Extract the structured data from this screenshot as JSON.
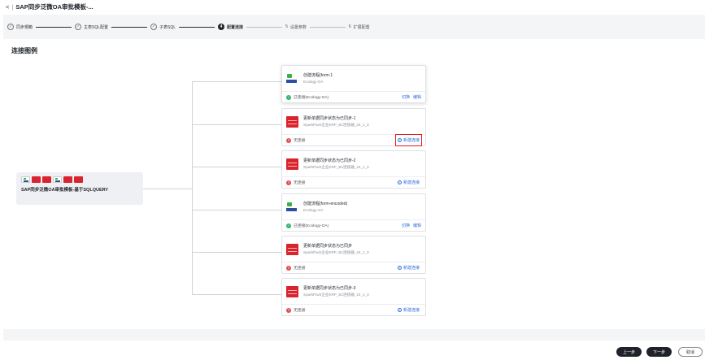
{
  "header": {
    "back_icon": "chevron-left-icon",
    "title": "SAP同步泛微OA审批模板-..."
  },
  "steps": [
    {
      "label": "同步規範",
      "state": "done",
      "marker": "✓"
    },
    {
      "label": "主表SQL配置",
      "state": "done",
      "marker": "✓"
    },
    {
      "label": "子表SQL",
      "state": "done",
      "marker": "✓"
    },
    {
      "label": "配置连接",
      "state": "active",
      "marker": "4"
    },
    {
      "label": "设置参数",
      "state": "todo",
      "marker": "5"
    },
    {
      "label": "扩展配置",
      "state": "todo",
      "marker": "6"
    }
  ],
  "section_title": "连接图例",
  "source": {
    "title": "SAP同步泛微OA审批模板-基于SQLQUERY"
  },
  "cards": [
    {
      "name": "创建流程(form-1",
      "sub": "Ecology-OA",
      "logo": "oa",
      "status": "已连接(Ecology-OA)",
      "status_type": "ok",
      "action1": "切换",
      "action2": "编辑"
    },
    {
      "name": "更新单据同步状态为已同步-1",
      "sub": "SparkPack企业ERP_B1连接器_24_1_0",
      "logo": "sp",
      "status": "无连接",
      "status_type": "err",
      "new_label": "新建连接",
      "highlight": true
    },
    {
      "name": "更新单据同步状态为已同步-2",
      "sub": "SparkPack企业ERP_B1连接器_24_1_0",
      "logo": "sp",
      "status": "无连接",
      "status_type": "err",
      "new_label": "新建连接"
    },
    {
      "name": "创建流程(form-encoded)",
      "sub": "Ecology-OA",
      "logo": "oa",
      "status": "已连接(Ecology-OA)",
      "status_type": "ok",
      "action1": "切换",
      "action2": "编辑"
    },
    {
      "name": "更新单据同步状态为已同步",
      "sub": "SparkPack企业ERP_B1连接器_24_1_0",
      "logo": "sp",
      "status": "无连接",
      "status_type": "err",
      "new_label": "新建连接"
    },
    {
      "name": "更新单据同步状态为已同步-3",
      "sub": "SparkPack企业ERP_B1连接器_24_1_0",
      "logo": "sp",
      "status": "无连接",
      "status_type": "err",
      "new_label": "新建连接"
    }
  ],
  "footer": {
    "prev": "上一步",
    "next": "下一步",
    "cancel": "取消"
  },
  "colors": {
    "accent": "#2f6fde",
    "ok": "#2fb36b",
    "error": "#e54b4b",
    "primary_button": "#1f2329",
    "highlight_box": "#e02020"
  }
}
